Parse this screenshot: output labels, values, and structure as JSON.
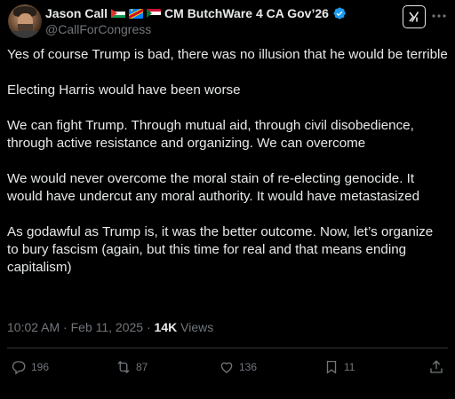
{
  "author": {
    "display_name": "Jason Call",
    "title_suffix": "CM ButchWare 4 CA Gov’26",
    "handle": "@CallForCongress",
    "flags": [
      "palestine-flag",
      "dr-congo-flag",
      "sudan-flag"
    ],
    "verified_color": "#1d9bf0"
  },
  "post": {
    "paragraphs": [
      "Yes of course Trump is bad, there was no illusion that he would be terrible",
      "Electing Harris would have been worse",
      "We can fight Trump. Through mutual aid, through civil disobedience, through active resistance and organizing. We can overcome",
      "We would never overcome the moral stain of re-electing genocide. It would have undercut any moral authority. It would have metastasized",
      "As godawful as Trump is, it was the better outcome. Now, let’s organize to bury fascism (again, but this time for real and that means ending capitalism)"
    ],
    "time": "10:02 AM",
    "date": "Feb 11, 2025",
    "separator": "·",
    "views_count": "14K",
    "views_label": "Views"
  },
  "actions": {
    "replies": "196",
    "reposts": "87",
    "likes": "136",
    "bookmarks": "11"
  },
  "colors": {
    "background": "#000000",
    "text": "#e7e9ea",
    "secondary": "#71767b",
    "divider": "#2f3336"
  }
}
